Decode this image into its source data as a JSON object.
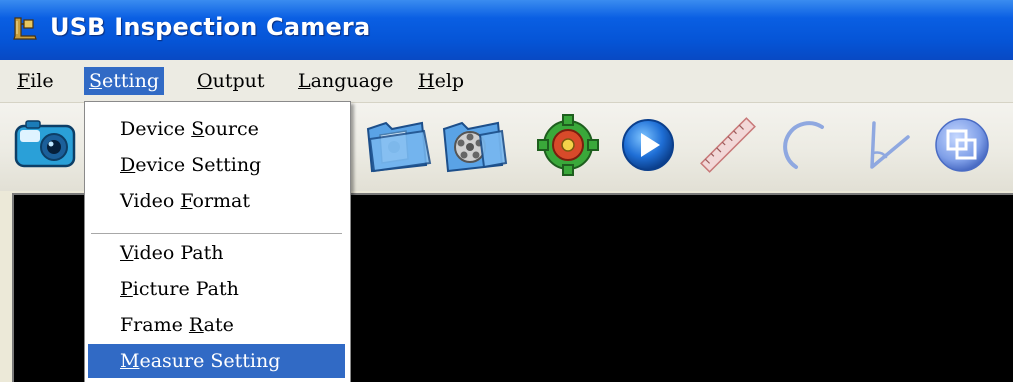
{
  "window": {
    "title": "USB Inspection Camera",
    "icon": "app-camera-icon",
    "title_bar_color": "#0554d6"
  },
  "menubar": {
    "items": [
      {
        "label_before": "",
        "mnemonic": "F",
        "label_after": "ile",
        "active": false
      },
      {
        "label_before": "",
        "mnemonic": "S",
        "label_after": "etting",
        "active": true
      },
      {
        "label_before": "",
        "mnemonic": "O",
        "label_after": "utput",
        "active": false
      },
      {
        "label_before": "",
        "mnemonic": "L",
        "label_after": "anguage",
        "active": false
      },
      {
        "label_before": "",
        "mnemonic": "H",
        "label_after": "elp",
        "active": false
      }
    ]
  },
  "setting_menu": {
    "highlight_color": "#316ac5",
    "items": [
      {
        "label_before": "Device ",
        "mnemonic": "S",
        "label_after": "ource",
        "highlighted": false
      },
      {
        "label_before": "",
        "mnemonic": "D",
        "label_after": "evice Setting",
        "highlighted": false
      },
      {
        "label_before": "Video ",
        "mnemonic": "F",
        "label_after": "ormat",
        "highlighted": false
      },
      {
        "label_before": "",
        "mnemonic": "V",
        "label_after": "ideo Path",
        "highlighted": false
      },
      {
        "label_before": "",
        "mnemonic": "P",
        "label_after": "icture Path",
        "highlighted": false
      },
      {
        "label_before": "Frame ",
        "mnemonic": "R",
        "label_after": "ate",
        "highlighted": false
      },
      {
        "label_before": "",
        "mnemonic": "M",
        "label_after": "easure Setting",
        "highlighted": true
      }
    ]
  },
  "toolbar": {
    "buttons": [
      {
        "icon": "camera-capture-icon"
      },
      {
        "icon": "picture-folder-icon"
      },
      {
        "icon": "video-folder-icon"
      },
      {
        "icon": "settings-gear-icon"
      },
      {
        "icon": "play-icon"
      },
      {
        "icon": "ruler-icon"
      },
      {
        "icon": "arc-measure-icon"
      },
      {
        "icon": "angle-measure-icon"
      },
      {
        "icon": "overlay-squares-icon"
      }
    ]
  },
  "viewport": {
    "background": "#000000"
  }
}
